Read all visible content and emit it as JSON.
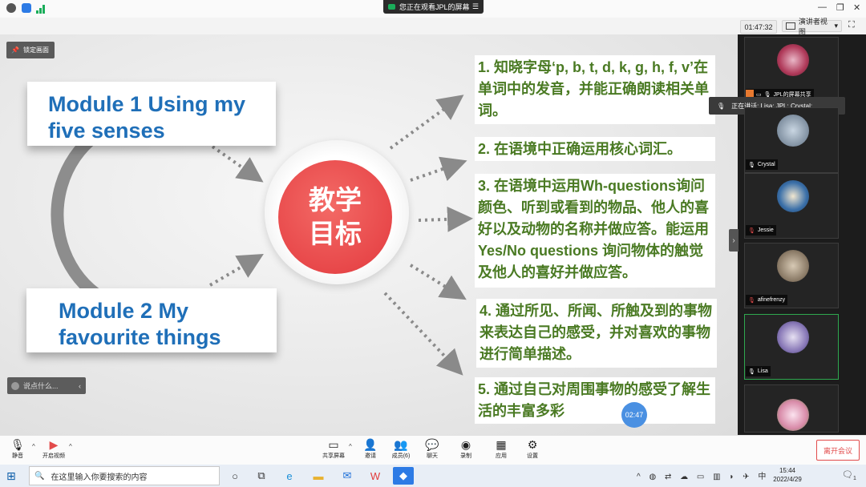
{
  "window": {
    "viewing_banner": "您正在观看JPL的屏幕",
    "banner_menu": "☰",
    "window_controls": [
      "—",
      "❐",
      "✕"
    ]
  },
  "toolbar": {
    "clock": "01:47:32",
    "view_mode": "演讲者视图",
    "view_caret": "▾",
    "fullscreen_icon": "⛶"
  },
  "slide": {
    "lock_button": "锁定画面",
    "module1": "Module 1 Using my five senses",
    "module2": "Module 2 My favourite things",
    "center_line1": "教学",
    "center_line2": "目标",
    "objectives": [
      "1. 知晓字母‘p, b, t, d, k, g, h, f, v’在单词中的发音，并能正确朗读相关单词。",
      "2. 在语境中正确运用核心词汇。",
      "3. 在语境中运用Wh-questions询问颜色、听到或看到的物品、他人的喜好以及动物的名称并做应答。能运用Yes/No questions 询问物体的触觉及他人的喜好并做应答。",
      "4. 通过所见、所闻、所触及到的事物来表达自己的感受，并对喜欢的事物进行简单描述。",
      "5. 通过自己对周围事物的感受了解生活的丰富多彩"
    ],
    "comment_placeholder": "说点什么...",
    "comment_caret": "‹",
    "timer_badge": "02:47"
  },
  "participants": {
    "speaking_tip": "正在讲话: Lisa; JPL; Crystal;",
    "tiles": [
      {
        "name": "JPL的屏幕共享",
        "color": "#b03a5a"
      },
      {
        "name": "Crystal",
        "color": "#7f8fa0"
      },
      {
        "name": "Jessie",
        "color": "#3a6fa8"
      },
      {
        "name": "afinefrenzy",
        "color": "#8a7a66"
      },
      {
        "name": "Lisa",
        "color": "#8a7ab8"
      },
      {
        "name": "",
        "color": "#d88aa8"
      }
    ],
    "collapse_icon": "›"
  },
  "controls": {
    "mute": "静音",
    "video": "开启视频",
    "share": "共享屏幕",
    "invite": "邀请",
    "members": "成员(6)",
    "chat": "聊天",
    "record": "录制",
    "apps": "应用",
    "settings": "设置",
    "leave": "离开会议"
  },
  "taskbar": {
    "search_placeholder": "在这里输入你要搜索的内容",
    "time": "15:44",
    "date": "2022/4/29",
    "tray_text": "中",
    "notif_count": "1"
  },
  "colors": {
    "accent_green": "#1aad5a",
    "module_blue": "#1f6fb8",
    "objective_green": "#4a7a23",
    "center_red": "#e8484a",
    "leave_red": "#e24b4b"
  }
}
